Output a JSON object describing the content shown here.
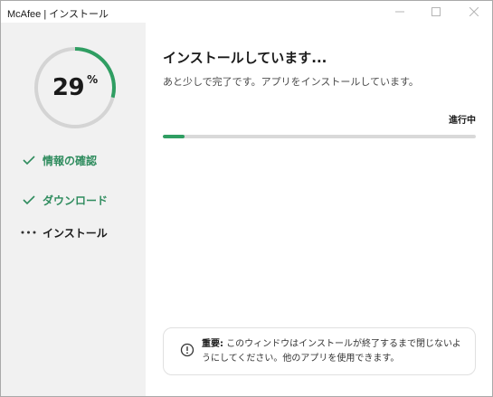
{
  "window": {
    "title": "McAfee | インストール"
  },
  "sidebar": {
    "progress": {
      "value": 29,
      "label": "29",
      "unit": "%",
      "color": "#2f9e62"
    },
    "steps": [
      {
        "label": "情報の確認",
        "state": "done",
        "icon": "check-icon"
      },
      {
        "label": "ダウンロード",
        "state": "done",
        "icon": "check-icon"
      },
      {
        "label": "インストール",
        "state": "active",
        "icon": "ellipsis-icon"
      }
    ]
  },
  "main": {
    "heading": "インストールしています...",
    "subtext": "あと少しで完了です。アプリをインストールしています。",
    "status": "進行中",
    "bar_progress": 0.07,
    "notice": {
      "icon": "info-icon",
      "strong": "重要:",
      "text": " このウィンドウはインストールが終了するまで閉じないようにしてください。他のアプリを使用できます。"
    }
  },
  "colors": {
    "accent": "#2f9e62",
    "step_done": "#2f8c5e",
    "sidebar_bg": "#f1f1f1"
  }
}
